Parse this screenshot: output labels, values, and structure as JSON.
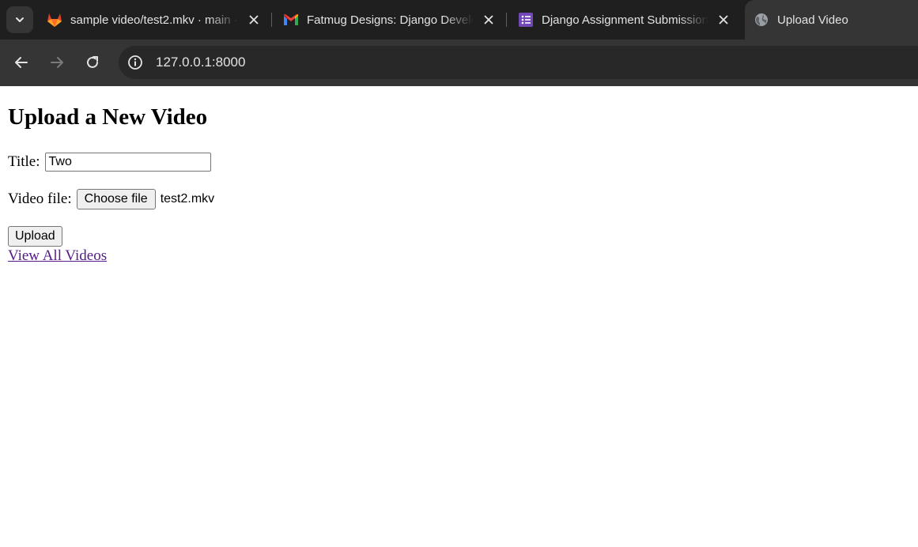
{
  "browser": {
    "tabs": [
      {
        "title": "sample video/test2.mkv · main ·",
        "favicon": "gitlab-icon",
        "active": false
      },
      {
        "title": "Fatmug Designs: Django Develo",
        "favicon": "gmail-icon",
        "active": false
      },
      {
        "title": "Django Assignment Submission",
        "favicon": "google-forms-icon",
        "active": false
      },
      {
        "title": "Upload Video",
        "favicon": "globe-icon",
        "active": true
      }
    ],
    "url": "127.0.0.1:8000",
    "colors": {
      "chrome_dark": "#1f1f1f",
      "chrome": "#353535",
      "omnibox": "#282828",
      "link_visited": "#551a8b"
    }
  },
  "page": {
    "heading": "Upload a New Video",
    "title_label": "Title:",
    "title_value": "Two",
    "video_label": "Video file:",
    "choose_file_label": "Choose file",
    "file_name": "test2.mkv",
    "upload_label": "Upload",
    "view_all_link": "View All Videos"
  }
}
